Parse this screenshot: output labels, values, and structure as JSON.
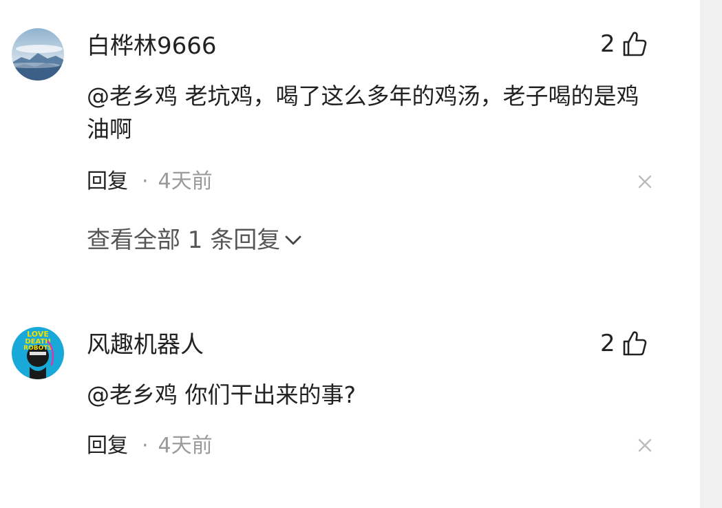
{
  "comments": [
    {
      "username": "白桦林9666",
      "likes": "2",
      "text": "@老乡鸡 老坑鸡，喝了这么多年的鸡汤，老子喝的是鸡油啊",
      "reply_label": "回复",
      "separator": "·",
      "time": "4天前",
      "view_replies": "查看全部 1 条回复"
    },
    {
      "username": "风趣机器人",
      "likes": "2",
      "text": "@老乡鸡 你们干出来的事?",
      "reply_label": "回复",
      "separator": "·",
      "time": "4天前"
    }
  ],
  "avatar_2_text": [
    "LOVE",
    "DEATH",
    "ROBOTS"
  ],
  "icons": {
    "like": "thumbs-up-icon",
    "close": "close-icon",
    "chevron": "chevron-down-icon"
  },
  "colors": {
    "text": "#222222",
    "muted": "#999999",
    "link": "#555555",
    "gutter": "#f1f1f1"
  }
}
